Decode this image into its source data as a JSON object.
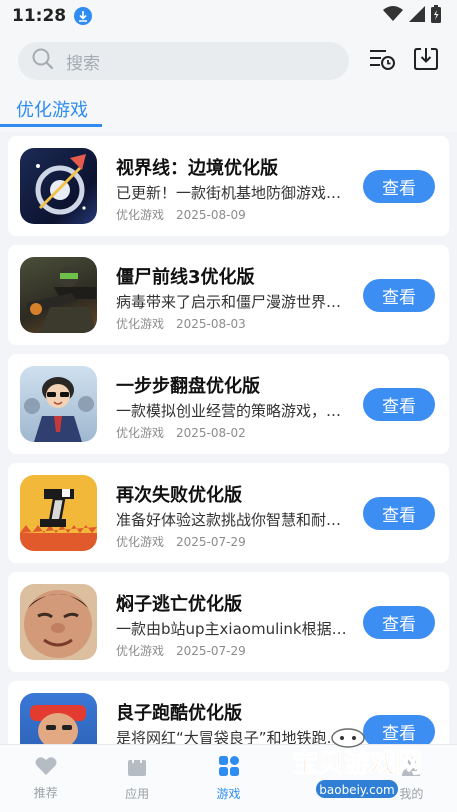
{
  "status": {
    "time": "11:28"
  },
  "search": {
    "placeholder": "搜索"
  },
  "tabs": {
    "active": "优化游戏"
  },
  "colors": {
    "accent": "#2f8cf0",
    "button": "#3d8ef2"
  },
  "games": [
    {
      "title": "视界线：边境优化版",
      "desc": "已更新！一款街机基地防御游戏，…",
      "category": "优化游戏",
      "date": "2025-08-09",
      "button": "查看",
      "icon": "space-station-icon"
    },
    {
      "title": "僵尸前线3优化版",
      "desc": "病毒带来了启示和僵尸漫游世界，…",
      "category": "优化游戏",
      "date": "2025-08-03",
      "button": "查看",
      "icon": "soldier-rifle-icon"
    },
    {
      "title": "一步步翻盘优化版",
      "desc": "一款模拟创业经营的策略游戏，…",
      "category": "优化游戏",
      "date": "2025-08-02",
      "button": "查看",
      "icon": "anime-businessman-icon"
    },
    {
      "title": "再次失败优化版",
      "desc": "准备好体验这款挑战你智慧和耐心…",
      "category": "优化游戏",
      "date": "2025-07-29",
      "button": "查看",
      "icon": "pixel-block-icon"
    },
    {
      "title": "焖子逃亡优化版",
      "desc": "一款由b站up主xiaomulink根据神…",
      "category": "优化游戏",
      "date": "2025-07-29",
      "button": "查看",
      "icon": "funny-face-icon"
    },
    {
      "title": "良子跑酷优化版",
      "desc": "是将网红“大冒袋良子”和地铁跑…",
      "category": "",
      "date": "",
      "button": "查看",
      "icon": "runner-character-icon"
    }
  ],
  "tabbar": [
    {
      "label": "推荐",
      "icon": "heart-icon"
    },
    {
      "label": "应用",
      "icon": "bag-icon"
    },
    {
      "label": "游戏",
      "icon": "grid-icon",
      "active": true
    },
    {
      "label": "",
      "icon": ""
    },
    {
      "label": "我的",
      "icon": "profile-icon"
    }
  ],
  "watermark": {
    "text": "宝贝游戏网",
    "url_text": "baobeiy.com"
  }
}
